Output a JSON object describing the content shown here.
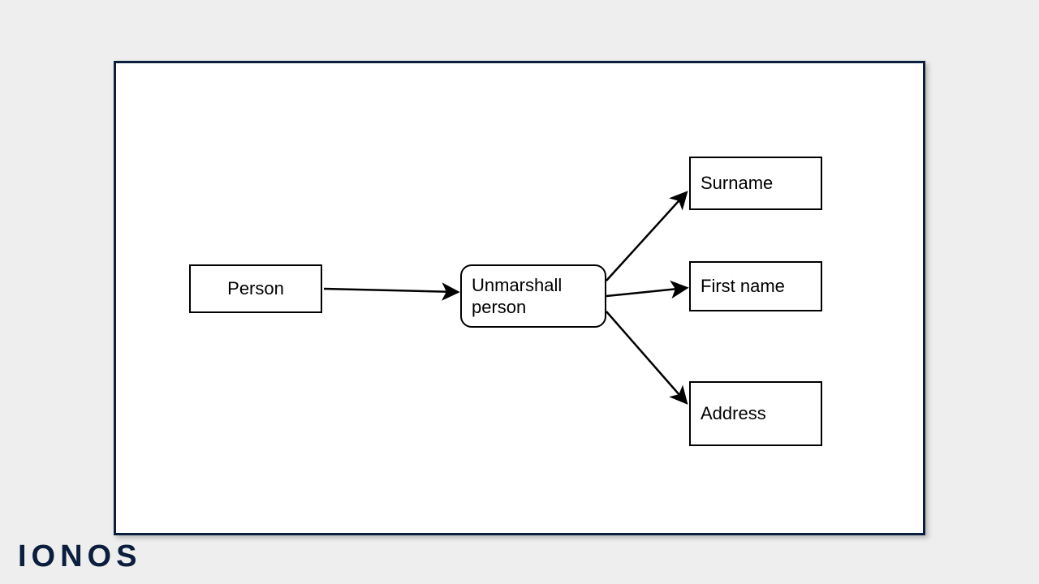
{
  "brand": "IONOS",
  "diagram": {
    "nodes": {
      "person": {
        "label": "Person"
      },
      "unmarshall": {
        "label": "Unmarshall person"
      },
      "surname": {
        "label": "Surname"
      },
      "firstname": {
        "label": "First name"
      },
      "address": {
        "label": "Address"
      }
    }
  }
}
